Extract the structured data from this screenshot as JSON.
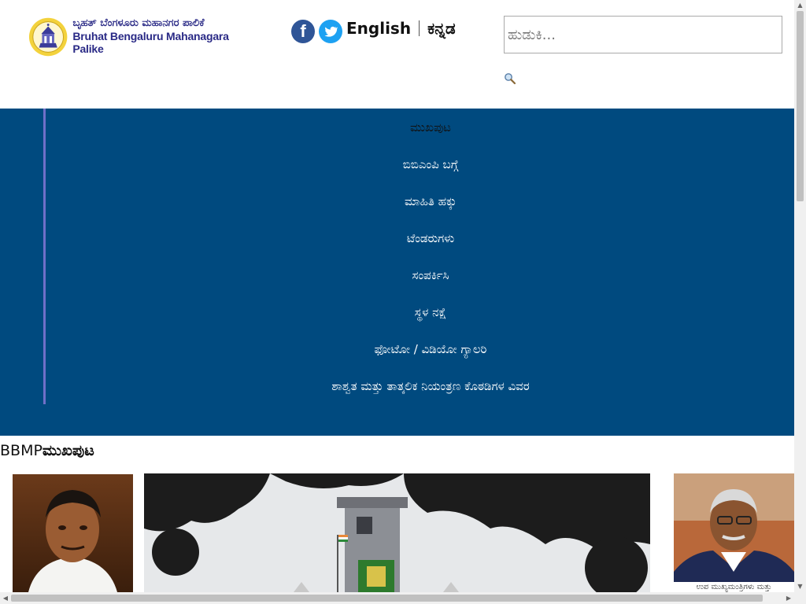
{
  "header": {
    "logo_kannada": "ಬೃಹತ್ ಬೆಂಗಳೂರು ಮಹಾನಗರ ಪಾಲಿಕೆ",
    "logo_english": "Bruhat Bengaluru Mahanagara Palike",
    "social": {
      "facebook_glyph": "f",
      "twitter_glyph": "t"
    },
    "lang_english": "English",
    "lang_kannada": "ಕನ್ನಡ",
    "search_placeholder": "ಹುಡುಕಿ...",
    "search_icon": "magnifier-icon"
  },
  "nav": {
    "items": [
      "ಮುಖಪುಟ",
      "ಬಿಬಿಎಂಪಿ ಬಗ್ಗೆ",
      "ಮಾಹಿತಿ ಹಕ್ಕು",
      "ಟೆಂಡರುಗಳು",
      "ಸಂಪರ್ಕಿಸಿ",
      "ಸ್ಥಳ ನಕ್ಷೆ",
      "ಫೋಟೋ / ವಿಡಿಯೋ ಗ್ಯಾಲರಿ",
      "ಶಾಶ್ವತ ಮತ್ತು ತಾತ್ಕಲಿಕ ನಿಯಂತ್ರಣ ಕೊಠಡಿಗಳ ವಿವರ"
    ]
  },
  "main": {
    "title_prefix": "BBMP",
    "title_suffix": "ಮುಖಪುಟ",
    "right_caption": "ಉಪ ಮುಖ್ಯಮಂತ್ರಿಗಳು ಮತ್ತು"
  },
  "colors": {
    "nav_bg": "#004a7f",
    "brand_text": "#2a2a86",
    "facebook": "#2f5597",
    "twitter": "#1da1f2"
  }
}
